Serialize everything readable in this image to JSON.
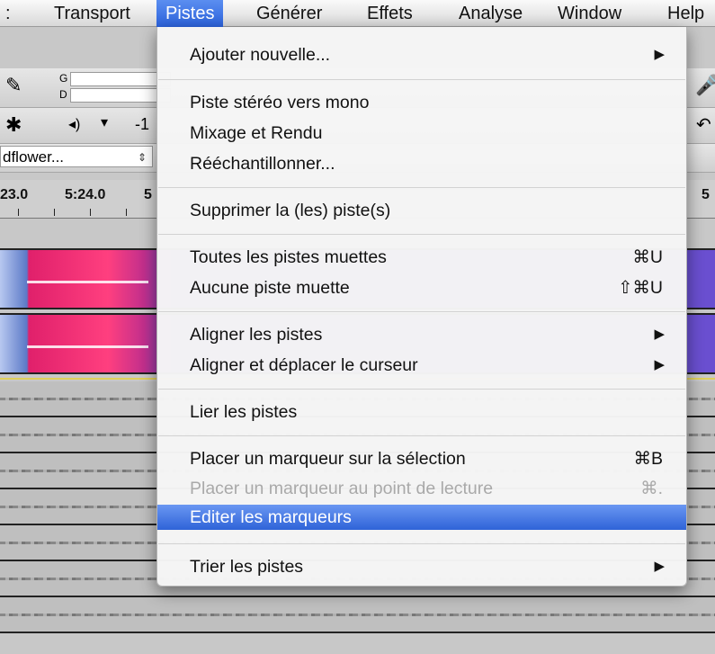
{
  "menubar": {
    "items": [
      "Transport",
      "Pistes",
      "Générer",
      "Effets",
      "Analyse",
      "Window",
      "Help"
    ],
    "active": "Pistes"
  },
  "toolbar": {
    "meter_labels": [
      "G",
      "D"
    ],
    "volume_value": "-1",
    "device_combo": "dflower...",
    "icons": [
      "pencil-icon",
      "multi-tool-icon",
      "speaker-icon",
      "dropdown-icon",
      "microphone-icon",
      "undo-icon"
    ]
  },
  "ruler": {
    "labels": [
      "23.0",
      "5:24.0",
      "5"
    ],
    "right_label": "5"
  },
  "pistes_menu": {
    "items": [
      {
        "label": "Ajouter nouvelle...",
        "submenu": true,
        "shortcut": ""
      },
      {
        "label": "Piste stéréo vers mono",
        "shortcut": ""
      },
      {
        "label": "Mixage et Rendu",
        "shortcut": ""
      },
      {
        "label": "Rééchantillonner...",
        "shortcut": ""
      },
      {
        "label": "Supprimer la (les) piste(s)",
        "shortcut": ""
      },
      {
        "label": "Toutes les pistes muettes",
        "shortcut": "⌘U"
      },
      {
        "label": "Aucune piste muette",
        "shortcut": "⇧⌘U"
      },
      {
        "label": "Aligner les pistes",
        "submenu": true,
        "shortcut": ""
      },
      {
        "label": "Aligner et déplacer le curseur",
        "submenu": true,
        "shortcut": ""
      },
      {
        "label": "Lier les pistes",
        "shortcut": ""
      },
      {
        "label": "Placer un marqueur sur la sélection",
        "shortcut": "⌘B"
      },
      {
        "label": "Placer un marqueur au point de lecture",
        "shortcut": "⌘.",
        "disabled": true
      },
      {
        "label": "Editer les marqueurs",
        "shortcut": "",
        "highlighted": true
      },
      {
        "label": "Trier les pistes",
        "submenu": true,
        "shortcut": ""
      }
    ],
    "submenu_arrow": "▶"
  },
  "colors": {
    "highlight": "#2f63d8",
    "disabled_text": "#a9a9a9",
    "spectrogram_pink": "#ff3f7f",
    "spectrogram_purple": "#6a4fd0"
  }
}
